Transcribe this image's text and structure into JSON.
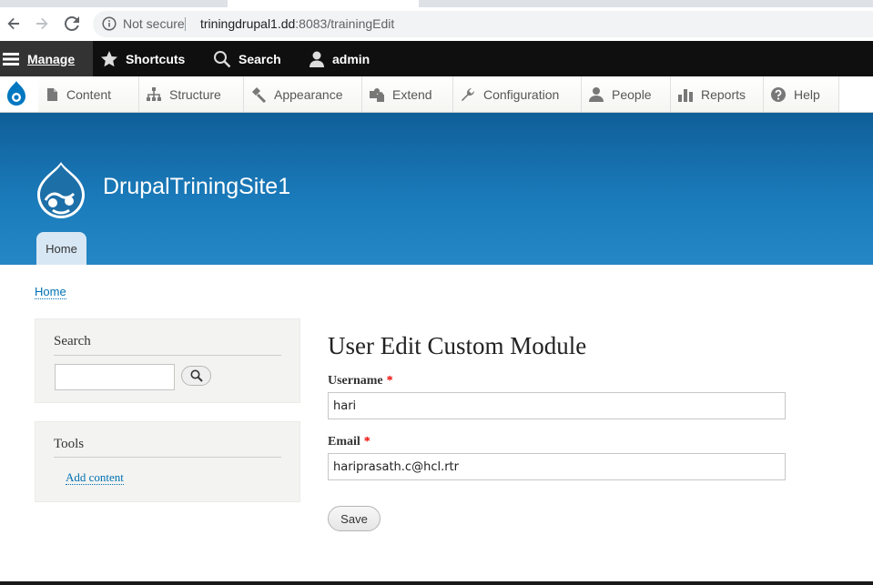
{
  "browser": {
    "security_label": "Not secure",
    "url_host": "triningdrupal1.dd",
    "url_path": ":8083/trainingEdit"
  },
  "toolbar": {
    "manage": "Manage",
    "shortcuts": "Shortcuts",
    "search": "Search",
    "user": "admin"
  },
  "tray": {
    "items": [
      {
        "label": "Content",
        "icon": "content-icon"
      },
      {
        "label": "Structure",
        "icon": "structure-icon"
      },
      {
        "label": "Appearance",
        "icon": "appearance-icon"
      },
      {
        "label": "Extend",
        "icon": "extend-icon"
      },
      {
        "label": "Configuration",
        "icon": "configuration-icon"
      },
      {
        "label": "People",
        "icon": "people-icon"
      },
      {
        "label": "Reports",
        "icon": "reports-icon"
      },
      {
        "label": "Help",
        "icon": "help-icon"
      }
    ]
  },
  "header": {
    "site_name": "DrupalTriningSite1",
    "nav_home": "Home"
  },
  "breadcrumb": {
    "home": "Home"
  },
  "sidebar": {
    "search_title": "Search",
    "search_value": "",
    "tools_title": "Tools",
    "tools_link": "Add content"
  },
  "form": {
    "title": "User Edit Custom Module",
    "username_label": "Username",
    "username_value": "hari",
    "email_label": "Email",
    "email_value": "hariprasath.c@hcl.rtr",
    "required_mark": "*",
    "save_label": "Save"
  },
  "colors": {
    "header_blue": "#1b7cbc",
    "link": "#0071b3",
    "required": "#e00000",
    "toolbar": "#0f0f0f"
  }
}
